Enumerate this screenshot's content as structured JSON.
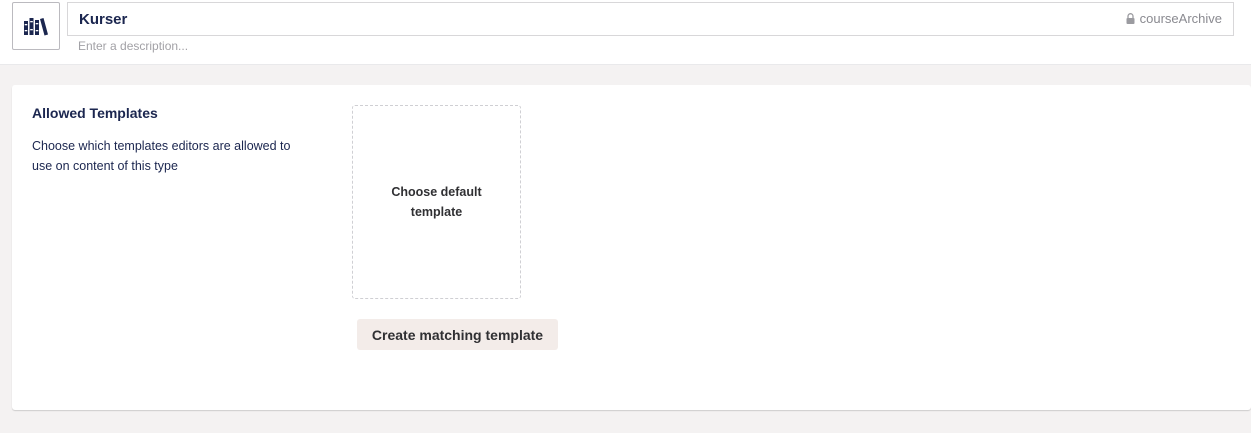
{
  "header": {
    "icon": "books-icon",
    "name_value": "Kurser",
    "alias": "courseArchive",
    "description_placeholder": "Enter a description..."
  },
  "section": {
    "title": "Allowed Templates",
    "description": "Choose which templates editors are allowed to use on content of this type",
    "picker_label": "Choose default template",
    "create_button_label": "Create matching template"
  }
}
